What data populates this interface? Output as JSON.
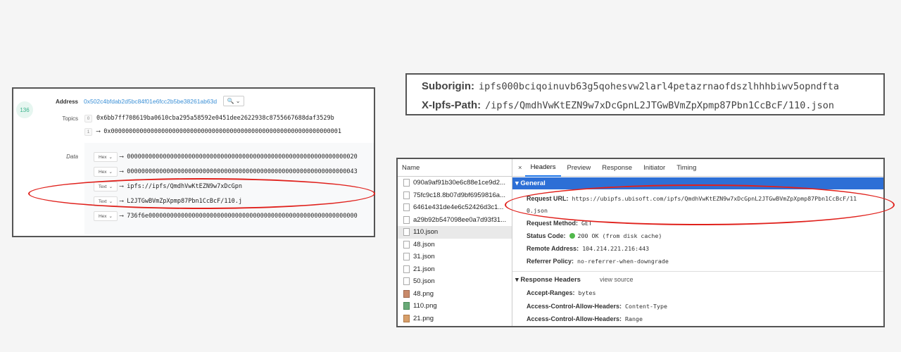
{
  "log": {
    "badge": "136",
    "address_label": "Address",
    "address": "0x502c4bfdab2d5bc84f01e6fcc2b5be38261ab63d",
    "zoom_button": "🔍 ⌄",
    "topics_label": "Topics",
    "topics": [
      {
        "idx": "0",
        "value": "0x6bb7ff708619ba0610cba295a58592e0451dee2622938c8755667688daf3529b"
      },
      {
        "idx": "1",
        "value": "⟶ 0x0000000000000000000000000000000000000000000000000000000000000001"
      }
    ],
    "data_label": "Data",
    "data_rows": [
      {
        "fmt": "Hex",
        "value": "⟶ 0000000000000000000000000000000000000000000000000000000000000020"
      },
      {
        "fmt": "Hex",
        "value": "⟶ 0000000000000000000000000000000000000000000000000000000000000043"
      },
      {
        "fmt": "Text",
        "value": "⟶ ipfs://ipfs/QmdhVwKtEZN9w7xDcGpn"
      },
      {
        "fmt": "Text",
        "value": "⟶ L2JTGwBVmZpXpmp87Pbn1CcBcF/110.j"
      },
      {
        "fmt": "Hex",
        "value": "⟶ 736f6e0000000000000000000000000000000000000000000000000000000000"
      }
    ]
  },
  "headers_snippet": {
    "suborigin_label": "Suborigin:",
    "suborigin_value": "ipfs000bciqoinuvb63g5qohesvw2larl4petazrnaofdszlhhhbiwv5opndfta",
    "path_label": "X-Ipfs-Path:",
    "path_value": "/ipfs/QmdhVwKtEZN9w7xDcGpnL2JTGwBVmZpXpmp87Pbn1CcBcF/110.json"
  },
  "devtools": {
    "name_header": "Name",
    "files": [
      {
        "name": "090a9af91b30e6c88e1ce9d2...",
        "icon": "doc"
      },
      {
        "name": "75fc9c18.8b07d9bf6959816a...",
        "icon": "doc"
      },
      {
        "name": "6461e431de4e6c52426d3c1...",
        "icon": "doc"
      },
      {
        "name": "a29b92b547098ee0a7d93f31...",
        "icon": "doc"
      },
      {
        "name": "110.json",
        "icon": "doc",
        "selected": true
      },
      {
        "name": "48.json",
        "icon": "doc"
      },
      {
        "name": "31.json",
        "icon": "doc"
      },
      {
        "name": "21.json",
        "icon": "doc"
      },
      {
        "name": "50.json",
        "icon": "doc"
      },
      {
        "name": "48.png",
        "icon": "img1"
      },
      {
        "name": "110.png",
        "icon": "img2"
      },
      {
        "name": "21.png",
        "icon": "img3"
      }
    ],
    "tabs": {
      "close": "×",
      "headers": "Headers",
      "preview": "Preview",
      "response": "Response",
      "initiator": "Initiator",
      "timing": "Timing"
    },
    "general_header": "▾ General",
    "request_url_label": "Request URL:",
    "request_url_1": "https://ubipfs.ubisoft.com/ipfs/QmdhVwKtEZN9w7xDcGpnL2JTGwBVmZpXpmp87Pbn1CcBcF/11",
    "request_url_2": "0.json",
    "request_method_label": "Request Method:",
    "request_method": "GET",
    "status_code_label": "Status Code:",
    "status_code": "200 OK (from disk cache)",
    "remote_address_label": "Remote Address:",
    "remote_address": "104.214.221.216:443",
    "referrer_policy_label": "Referrer Policy:",
    "referrer_policy": "no-referrer-when-downgrade",
    "response_headers_title": "▾ Response Headers",
    "view_source": "view source",
    "accept_ranges_label": "Accept-Ranges:",
    "accept_ranges": "bytes",
    "acah_label": "Access-Control-Allow-Headers:",
    "acah": "Content-Type",
    "acah2_label": "Access-Control-Allow-Headers:",
    "acah2": "Range"
  },
  "colors": {
    "annotation": "#e0211c",
    "general_header_bg": "#2d6fd6",
    "address_link": "#3a8fd6"
  }
}
